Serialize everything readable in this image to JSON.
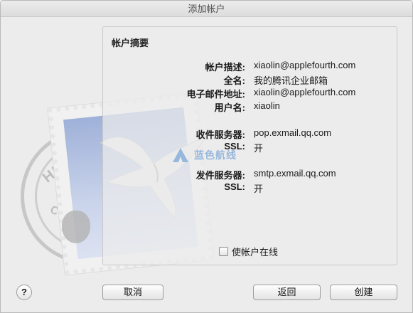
{
  "window": {
    "title": "添加帐户"
  },
  "illustration": {
    "postmark_top": "HELLO FR",
    "postmark_bottom": "CUPERTINO, CA",
    "icon": "mail-stamp-icon"
  },
  "summary": {
    "heading": "帐户摘要",
    "rows": [
      {
        "label": "帐户描述:",
        "value": "xiaolin@applefourth.com"
      },
      {
        "label": "全名:",
        "value": "我的腾讯企业邮箱"
      },
      {
        "label": "电子邮件地址:",
        "value": "xiaolin@applefourth.com"
      },
      {
        "label": "用户名:",
        "value": "xiaolin"
      },
      {
        "label": "收件服务器:",
        "value": "pop.exmail.qq.com"
      },
      {
        "label": "SSL:",
        "value": "开"
      },
      {
        "label": "发件服务器:",
        "value": "smtp.exmail.qq.com"
      },
      {
        "label": "SSL:",
        "value": "开"
      }
    ],
    "online_checkbox_label": "使帐户在线",
    "online_checked": false
  },
  "watermark": {
    "text": "蓝色航线"
  },
  "buttons": {
    "help": "?",
    "cancel": "取消",
    "back": "返回",
    "create": "创建"
  }
}
